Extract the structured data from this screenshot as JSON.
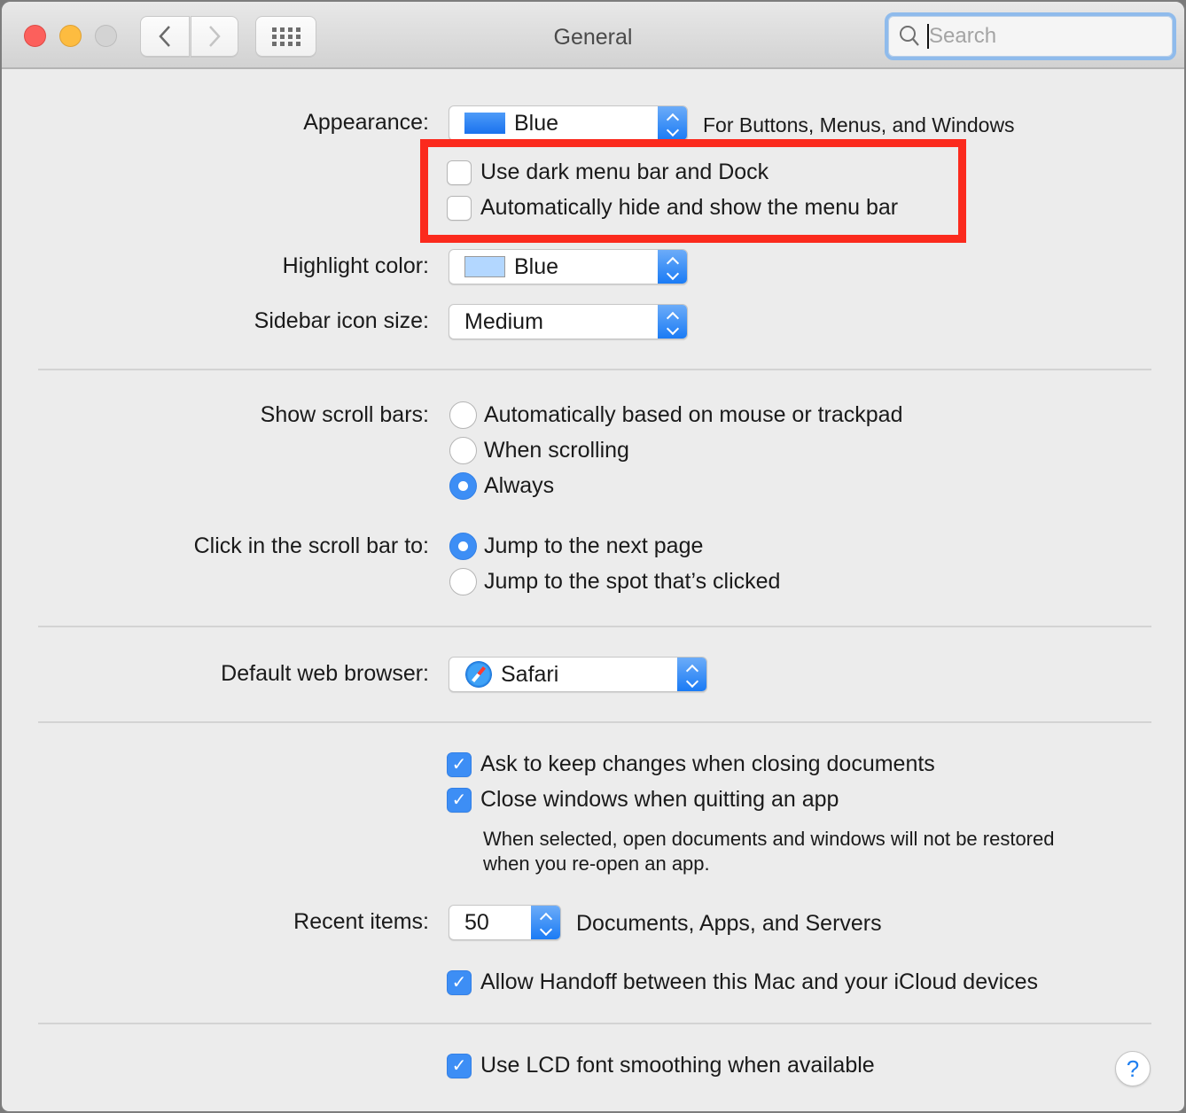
{
  "window": {
    "title": "General",
    "search": {
      "placeholder": "Search",
      "value": ""
    }
  },
  "appearance": {
    "label": "Appearance:",
    "value": "Blue",
    "swatch_color": "#1a7ef5",
    "note": "For Buttons, Menus, and Windows"
  },
  "menubar_options": [
    {
      "label": "Use dark menu bar and Dock",
      "checked": false
    },
    {
      "label": "Automatically hide and show the menu bar",
      "checked": false
    }
  ],
  "highlight": {
    "label": "Highlight color:",
    "value": "Blue",
    "swatch_color": "#b3d7ff"
  },
  "sidebar_icon_size": {
    "label": "Sidebar icon size:",
    "value": "Medium"
  },
  "scroll_bars": {
    "label": "Show scroll bars:",
    "options": [
      {
        "label": "Automatically based on mouse or trackpad",
        "selected": false
      },
      {
        "label": "When scrolling",
        "selected": false
      },
      {
        "label": "Always",
        "selected": true
      }
    ]
  },
  "scroll_click": {
    "label": "Click in the scroll bar to:",
    "options": [
      {
        "label": "Jump to the next page",
        "selected": true
      },
      {
        "label": "Jump to the spot that’s clicked",
        "selected": false
      }
    ]
  },
  "browser": {
    "label": "Default web browser:",
    "value": "Safari"
  },
  "documents": [
    {
      "label": "Ask to keep changes when closing documents",
      "checked": true
    },
    {
      "label": "Close windows when quitting an app",
      "checked": true
    }
  ],
  "close_windows_note_line1": "When selected, open documents and windows will not be restored",
  "close_windows_note_line2": "when you re-open an app.",
  "recent_items": {
    "label": "Recent items:",
    "value": "50",
    "note": "Documents, Apps, and Servers"
  },
  "handoff": {
    "label": "Allow Handoff between this Mac and your iCloud devices",
    "checked": true
  },
  "lcd": {
    "label": "Use LCD font smoothing when available",
    "checked": true
  },
  "help_label": "?",
  "checkmark": "✓",
  "colors": {
    "accent": "#3d8ef5",
    "annotation": "#fb2a1d"
  }
}
